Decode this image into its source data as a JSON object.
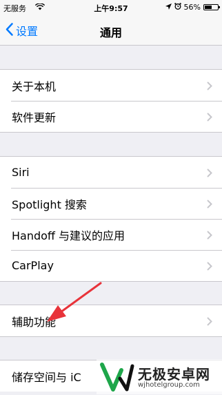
{
  "status_bar": {
    "carrier": "无服务",
    "time": "上午9:57",
    "battery": "56%",
    "battery_level": 0.56
  },
  "nav": {
    "back_label": "设置",
    "title": "通用"
  },
  "groups": [
    {
      "items": [
        {
          "label": "关于本机"
        },
        {
          "label": "软件更新"
        }
      ]
    },
    {
      "items": [
        {
          "label": "Siri"
        },
        {
          "label": "Spotlight 搜索"
        },
        {
          "label": "Handoff 与建议的应用"
        },
        {
          "label": "CarPlay"
        }
      ]
    },
    {
      "items": [
        {
          "label": "辅助功能"
        }
      ]
    },
    {
      "items": [
        {
          "label": "储存空间与 iC"
        }
      ]
    }
  ],
  "watermark": {
    "title": "无极安卓网",
    "url": "wjhotelgroup.com"
  },
  "colors": {
    "accent": "#007aff",
    "background": "#efeff4",
    "arrow": "#e8333a"
  }
}
